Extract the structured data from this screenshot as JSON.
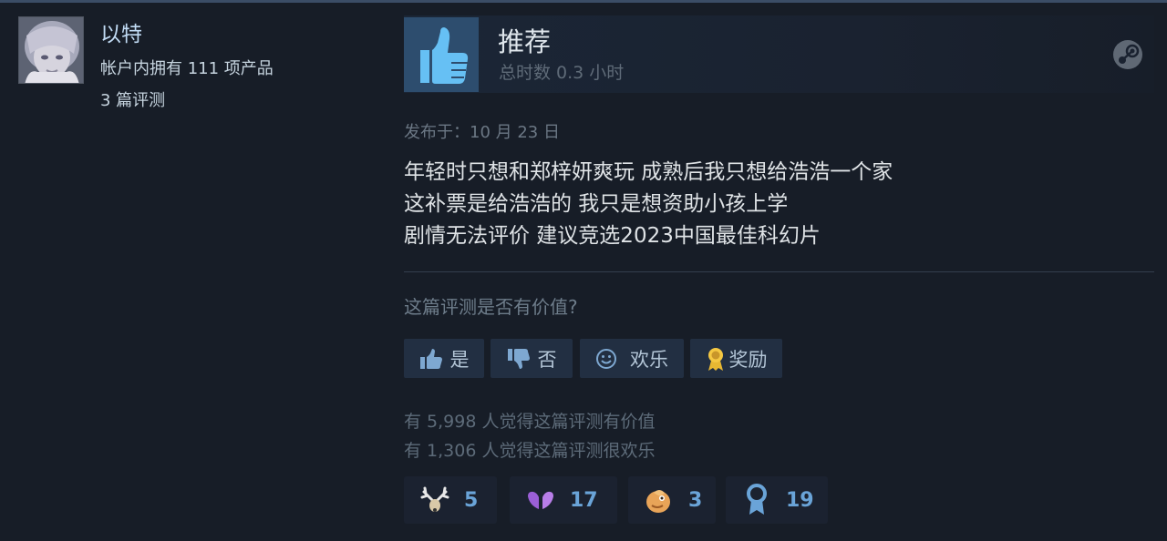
{
  "author": {
    "name": "以特",
    "products_owned": "帐户内拥有 111 项产品",
    "reviews_count": "3 篇评测"
  },
  "review": {
    "verdict": "推荐",
    "playtime": "总时数 0.3 小时",
    "posted": "发布于：10 月 23 日",
    "lines": [
      "年轻时只想和郑梓妍爽玩 成熟后我只想给浩浩一个家",
      "这补票是给浩浩的 我只是想资助小孩上学",
      "剧情无法评价 建议竞选2023中国最佳科幻片"
    ]
  },
  "feedback": {
    "question": "这篇评测是否有价值?",
    "buttons": {
      "yes": "是",
      "no": "否",
      "funny": "欢乐",
      "award": "奖励"
    },
    "helpful_stat": "有 5,998 人觉得这篇评测有价值",
    "funny_stat": "有 1,306 人觉得这篇评测很欢乐"
  },
  "awards": [
    {
      "icon": "deer-antlers-icon",
      "count": "5"
    },
    {
      "icon": "purple-hearts-icon",
      "count": "17"
    },
    {
      "icon": "clapping-hand-icon",
      "count": "3"
    },
    {
      "icon": "ribbon-medal-icon",
      "count": "19"
    }
  ],
  "colors": {
    "background": "#171d27",
    "accent_blue": "#6aa4d8",
    "thumb_bg": "#2d4d6e",
    "button_bg": "#222f42"
  }
}
